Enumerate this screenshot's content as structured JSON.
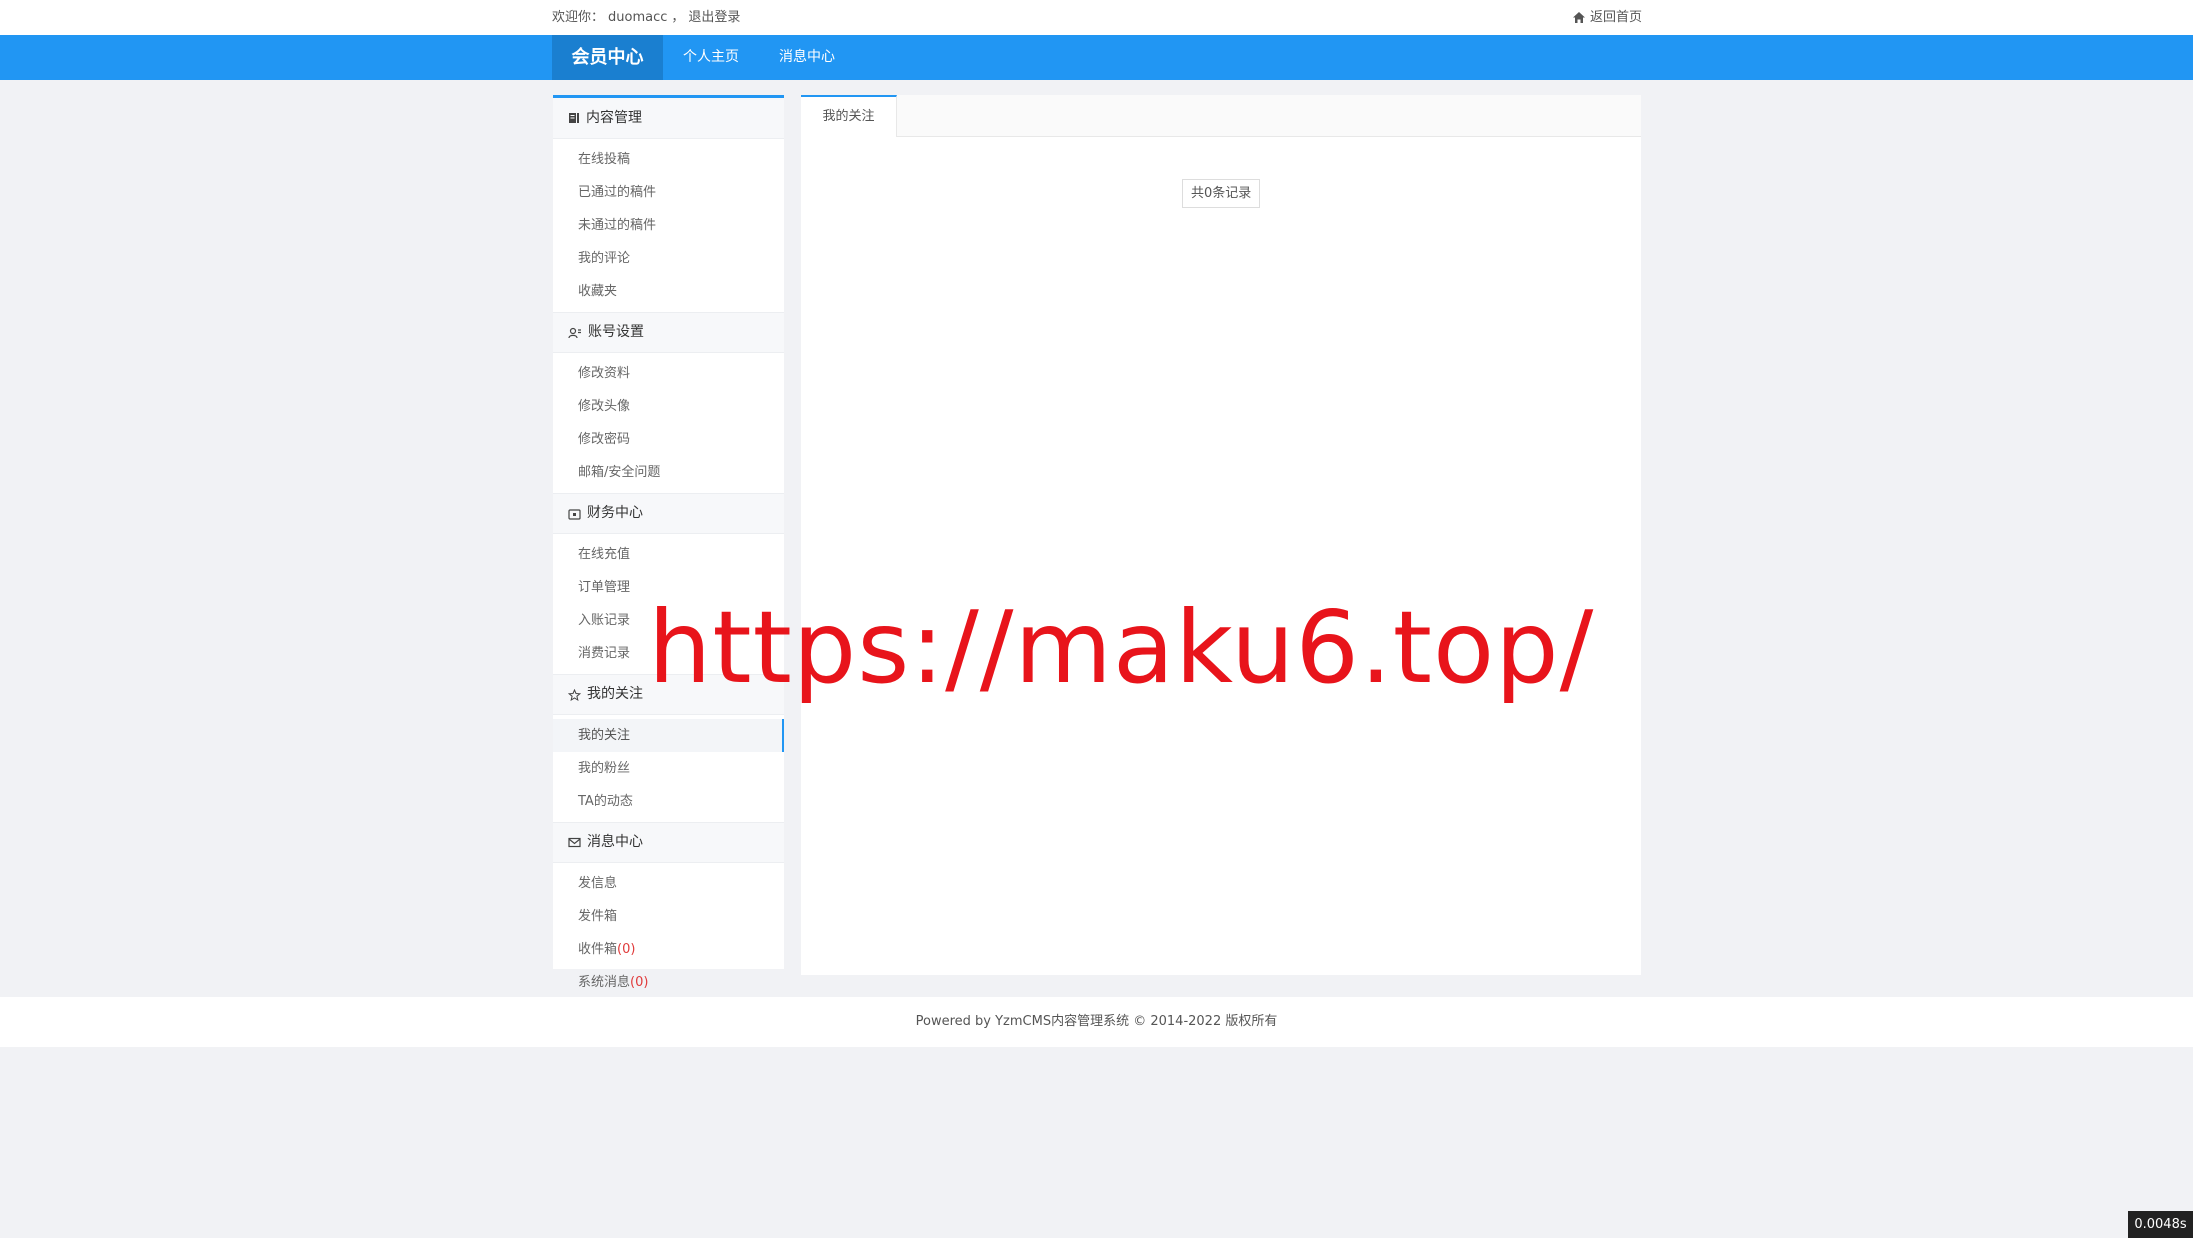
{
  "topbar": {
    "welcome_prefix": "欢迎你：",
    "username": "duomacc",
    "separator": "，",
    "logout": "退出登录",
    "home": "返回首页"
  },
  "navbar": {
    "brand": "会员中心",
    "links": [
      "个人主页",
      "消息中心"
    ]
  },
  "sidebar": {
    "groups": [
      {
        "title": "内容管理",
        "icon": "document-icon",
        "items": [
          "在线投稿",
          "已通过的稿件",
          "未通过的稿件",
          "我的评论",
          "收藏夹"
        ]
      },
      {
        "title": "账号设置",
        "icon": "user-settings-icon",
        "items": [
          "修改资料",
          "修改头像",
          "修改密码",
          "邮箱/安全问题"
        ]
      },
      {
        "title": "财务中心",
        "icon": "wallet-icon",
        "items": [
          "在线充值",
          "订单管理",
          "入账记录",
          "消费记录"
        ]
      },
      {
        "title": "我的关注",
        "icon": "star-icon",
        "items": [
          "我的关注",
          "我的粉丝",
          "TA的动态"
        ]
      },
      {
        "title": "消息中心",
        "icon": "mail-icon",
        "items": [
          "发信息",
          "发件箱",
          "收件箱",
          "系统消息"
        ]
      }
    ],
    "inbox_count": "(0)",
    "system_count": "(0)"
  },
  "main": {
    "tab": "我的关注",
    "records": "共0条记录"
  },
  "footer": "Powered by YzmCMS内容管理系统 © 2014-2022 版权所有",
  "watermark": "https://maku6.top/",
  "timer": "0.0048s",
  "colors": {
    "primary": "#2196f3",
    "brand_bg": "#1a7fd0",
    "count": "#e03b3b",
    "watermark": "#e8141b"
  }
}
